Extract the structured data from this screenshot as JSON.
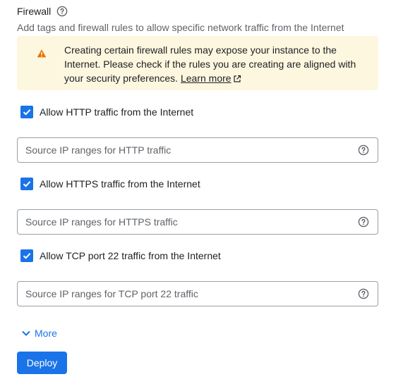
{
  "section": {
    "title": "Firewall",
    "description": "Add tags and firewall rules to allow specific network traffic from the Internet"
  },
  "warning": {
    "text": "Creating certain firewall rules may expose your instance to the Internet. Please check if the rules you are creating are aligned with your security preferences.",
    "link_label": "Learn more"
  },
  "rules": [
    {
      "label": "Allow HTTP traffic from the Internet",
      "checked": true,
      "placeholder": "Source IP ranges for HTTP traffic"
    },
    {
      "label": "Allow HTTPS traffic from the Internet",
      "checked": true,
      "placeholder": "Source IP ranges for HTTPS traffic"
    },
    {
      "label": "Allow TCP port 22 traffic from the Internet",
      "checked": true,
      "placeholder": "Source IP ranges for TCP port 22 traffic"
    }
  ],
  "more_label": "More",
  "deploy_label": "Deploy",
  "colors": {
    "accent": "#1a73e8",
    "warning_bg": "#fef7e0",
    "warning_icon": "#e37400"
  },
  "icons": {
    "help": "help-circle-icon",
    "warning": "warning-triangle-icon",
    "external": "external-link-icon",
    "check": "check-icon",
    "expand": "chevron-down-icon"
  }
}
